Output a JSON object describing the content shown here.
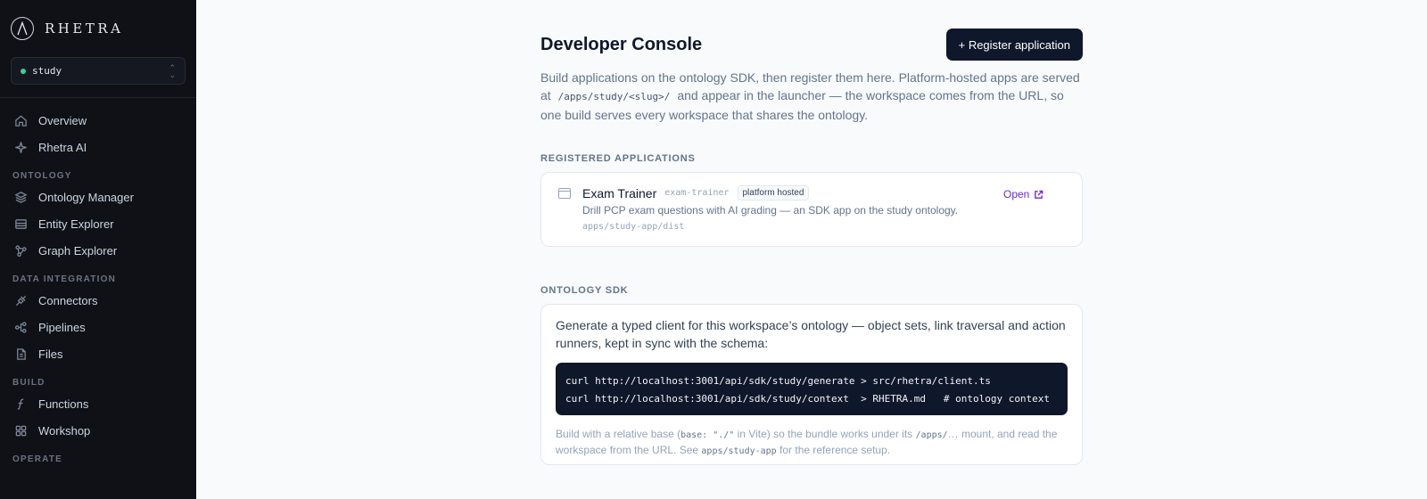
{
  "brand": {
    "name": "RHETRA"
  },
  "workspace": {
    "name": "study",
    "status_color": "#34d399"
  },
  "nav": {
    "top": [
      {
        "label": "Overview",
        "icon": "home-icon"
      },
      {
        "label": "Rhetra AI",
        "icon": "sparkle-icon"
      }
    ],
    "ontology_section": "ONTOLOGY",
    "ontology": [
      {
        "label": "Ontology Manager",
        "icon": "layers-icon"
      },
      {
        "label": "Entity Explorer",
        "icon": "table-icon"
      },
      {
        "label": "Graph Explorer",
        "icon": "graph-icon"
      }
    ],
    "data_integration_section": "DATA INTEGRATION",
    "data_integration": [
      {
        "label": "Connectors",
        "icon": "plug-icon"
      },
      {
        "label": "Pipelines",
        "icon": "pipeline-icon"
      },
      {
        "label": "Files",
        "icon": "file-icon"
      }
    ],
    "build_section": "BUILD",
    "build": [
      {
        "label": "Functions",
        "icon": "function-icon"
      },
      {
        "label": "Workshop",
        "icon": "grid-icon"
      }
    ],
    "operate_section": "OPERATE"
  },
  "page": {
    "title": "Developer Console",
    "register_button": "+ Register application",
    "intro_before": "Build applications on the ontology SDK, then register them here. Platform-hosted apps are served at",
    "intro_code": "/apps/study/<slug>/",
    "intro_after": "and appear in the launcher — the workspace comes from the URL, so one build serves every workspace that shares the ontology."
  },
  "registered": {
    "label": "REGISTERED APPLICATIONS",
    "apps": [
      {
        "name": "Exam Trainer",
        "slug": "exam-trainer",
        "badge": "platform hosted",
        "description": "Drill PCP exam questions with AI grading — an SDK app on the study ontology.",
        "path": "apps/study-app/dist",
        "open_label": "Open"
      }
    ]
  },
  "sdk": {
    "label": "ONTOLOGY SDK",
    "description": "Generate a typed client for this workspace’s ontology — object sets, link traversal and action runners, kept in sync with the schema:",
    "code_lines": [
      "curl http://localhost:3001/api/sdk/study/generate > src/rhetra/client.ts",
      "curl http://localhost:3001/api/sdk/study/context  > RHETRA.md   # ontology context"
    ],
    "note_1": "Build with a relative base (",
    "note_code_1": "base: \"./\"",
    "note_2": " in Vite) so the bundle works under its ",
    "note_code_2": "/apps/",
    "note_3": "… mount, and read the workspace from the URL. See ",
    "note_code_3": "apps/study-app",
    "note_4": " for the reference setup."
  }
}
